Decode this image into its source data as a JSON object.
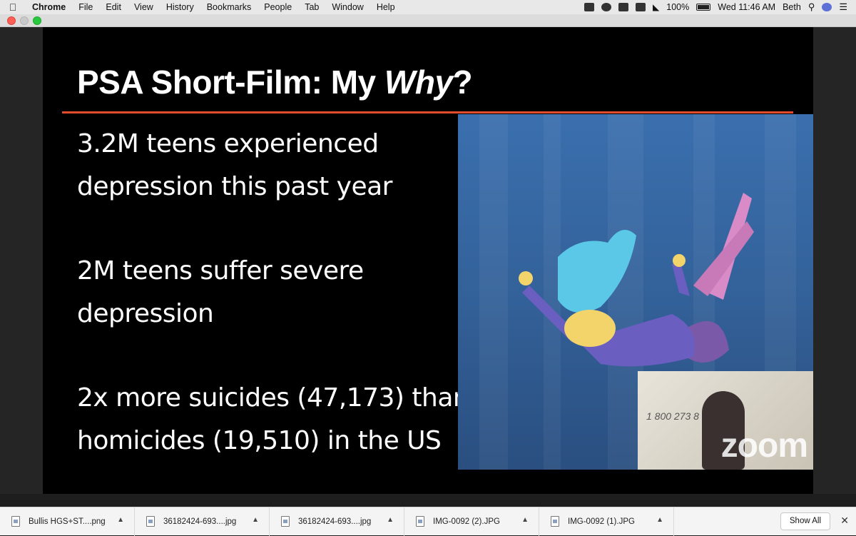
{
  "menubar": {
    "app": "Chrome",
    "items": [
      "File",
      "Edit",
      "View",
      "History",
      "Bookmarks",
      "People",
      "Tab",
      "Window",
      "Help"
    ],
    "battery": "100%",
    "clock": "Wed 11:46 AM",
    "user": "Beth"
  },
  "slide": {
    "title_prefix": "PSA Short-Film: My ",
    "title_emphasis": "Why",
    "title_suffix": "?",
    "accent_color": "#e24b2c",
    "stats": [
      {
        "line1": "3.2M teens experienced",
        "line2": "depression this past year"
      },
      {
        "line1": "2M teens suffer severe",
        "line2": "depression"
      },
      {
        "line1": "2x more suicides (47,173) than",
        "line2": "homicides (19,510) in the US"
      }
    ]
  },
  "video": {
    "watermark": "zoom",
    "pip_text": "1 800 273 8"
  },
  "downloads": {
    "items": [
      {
        "name": "Bullis HGS+ST....png"
      },
      {
        "name": "36182424-693....jpg"
      },
      {
        "name": "36182424-693....jpg"
      },
      {
        "name": "IMG-0092 (2).JPG"
      },
      {
        "name": "IMG-0092 (1).JPG"
      }
    ],
    "show_all": "Show All"
  }
}
